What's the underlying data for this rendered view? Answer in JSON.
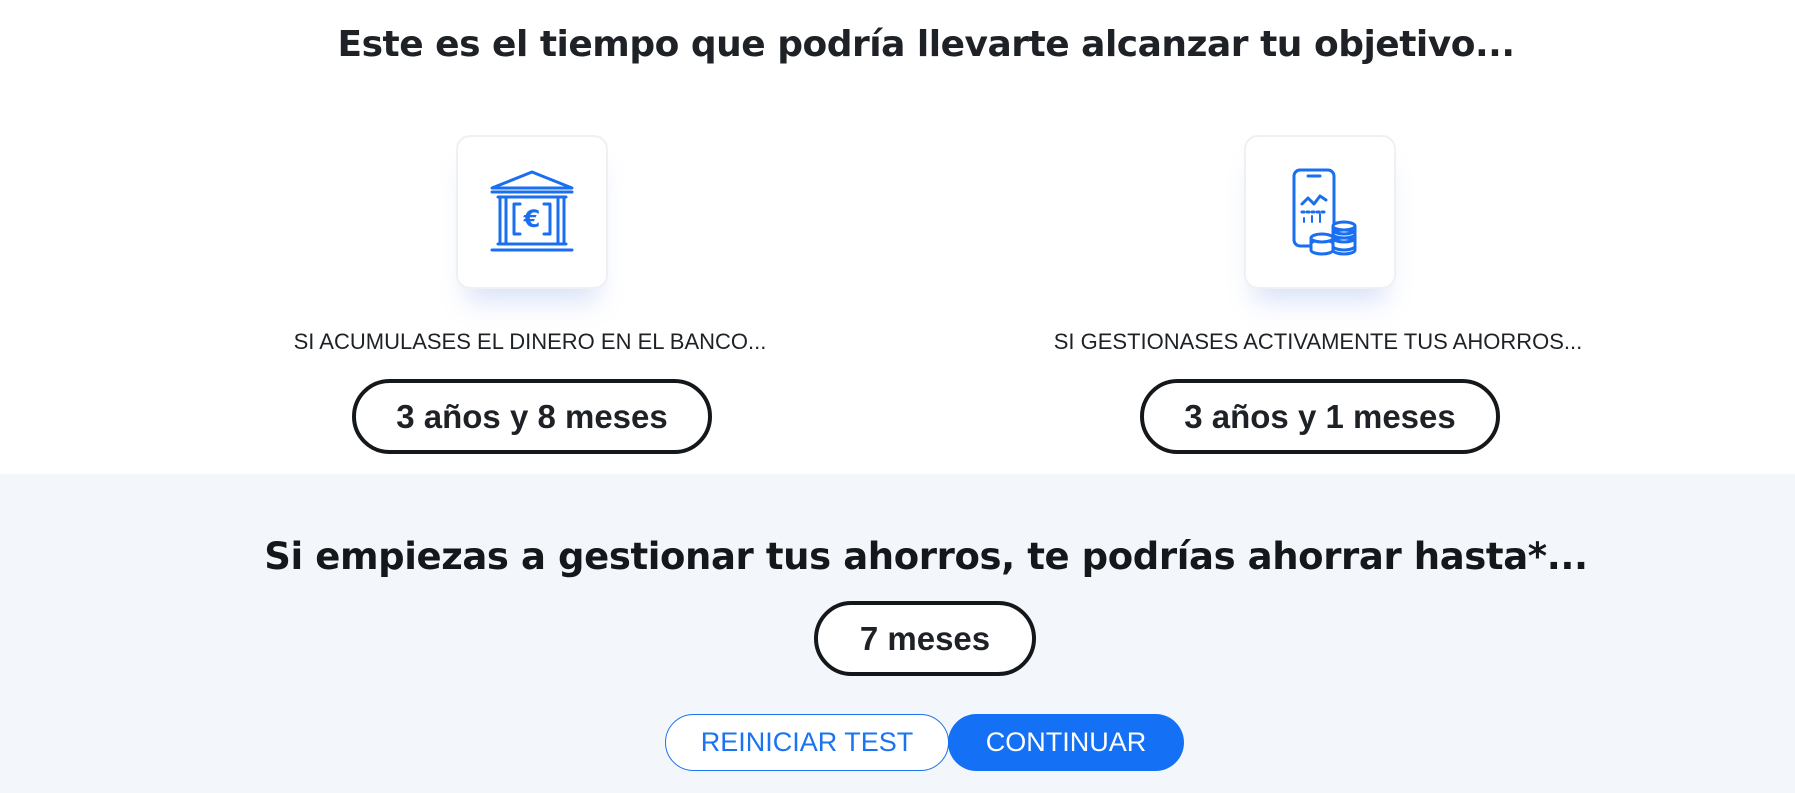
{
  "main_heading": "Este es el tiempo que podría llevarte alcanzar tu objetivo...",
  "options": [
    {
      "icon": "bank-euro-icon",
      "label": "SI ACUMULASES EL DINERO EN EL BANCO...",
      "duration": "3 años y 8 meses"
    },
    {
      "icon": "phone-chart-coins-icon",
      "label": "SI GESTIONASES ACTIVAMENTE TUS AHORROS...",
      "duration": "3 años y 1 meses"
    }
  ],
  "savings": {
    "heading": "Si empiezas a gestionar tus ahorros, te podrías ahorrar hasta*...",
    "value": "7 meses"
  },
  "buttons": {
    "restart_label": "REINICIAR TEST",
    "continue_label": "CONTINUAR"
  },
  "colors": {
    "accent": "#1470f5",
    "icon_blue": "#1a6ff0",
    "text": "#1e2226",
    "bottom_background": "#f3f6fb"
  }
}
